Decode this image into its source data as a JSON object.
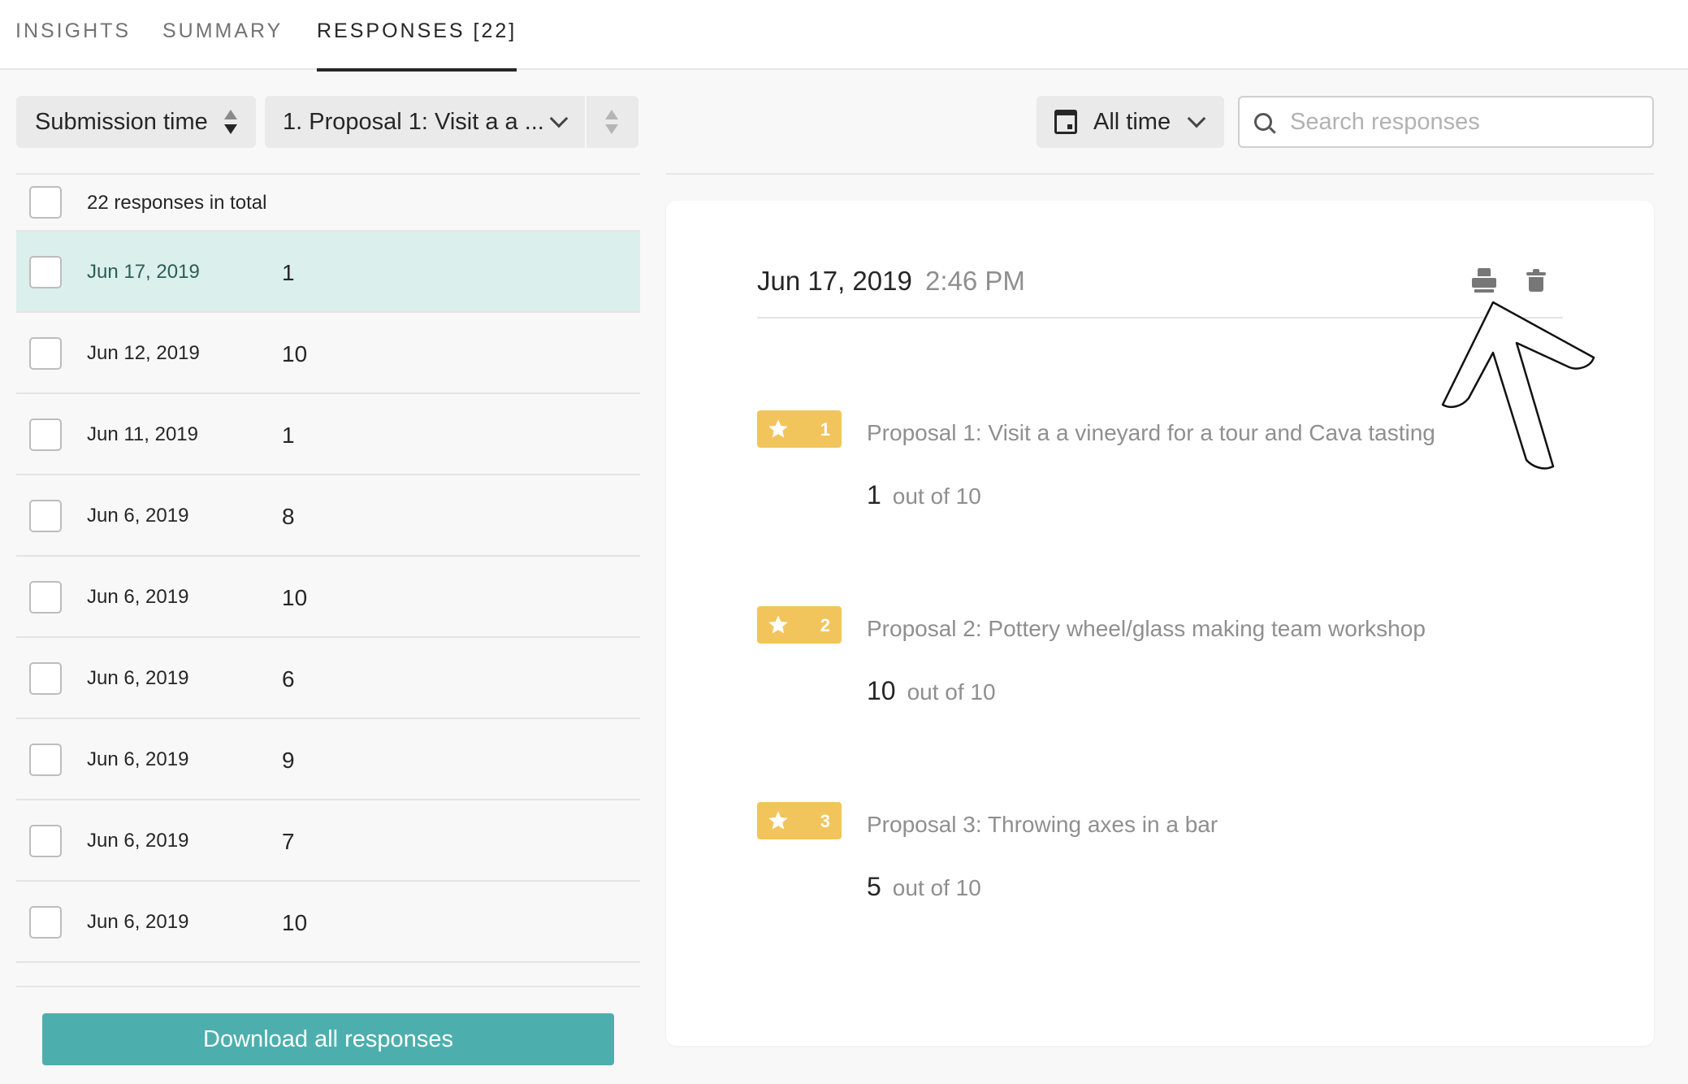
{
  "tabs": [
    {
      "label": "Insights",
      "active": false
    },
    {
      "label": "Summary",
      "active": false
    },
    {
      "label": "Responses [22]",
      "active": true
    }
  ],
  "controls": {
    "sort_label": "Submission time",
    "question_label": "1. Proposal 1: Visit a a ...",
    "date_filter_label": "All time",
    "search_placeholder": "Search responses"
  },
  "list": {
    "total_label": "22 responses in total",
    "rows": [
      {
        "date": "Jun 17, 2019",
        "score": "1",
        "selected": true
      },
      {
        "date": "Jun 12, 2019",
        "score": "10"
      },
      {
        "date": "Jun 11, 2019",
        "score": "1"
      },
      {
        "date": "Jun 6, 2019",
        "score": "8"
      },
      {
        "date": "Jun 6, 2019",
        "score": "10"
      },
      {
        "date": "Jun 6, 2019",
        "score": "6"
      },
      {
        "date": "Jun 6, 2019",
        "score": "9"
      },
      {
        "date": "Jun 6, 2019",
        "score": "7"
      },
      {
        "date": "Jun 6, 2019",
        "score": "10"
      }
    ],
    "download_label": "Download all responses"
  },
  "detail": {
    "date": "Jun 17, 2019",
    "time": "2:46 PM",
    "answers": [
      {
        "number": "1",
        "title": "Proposal 1: Visit a a vineyard for a tour and Cava tasting",
        "value": "1",
        "out_of": "out of 10"
      },
      {
        "number": "2",
        "title": "Proposal 2: Pottery wheel/glass making team workshop",
        "value": "10",
        "out_of": "out of 10"
      },
      {
        "number": "3",
        "title": "Proposal 3: Throwing axes in a bar",
        "value": "5",
        "out_of": "out of 10"
      }
    ]
  },
  "colors": {
    "accent": "#4cafad",
    "selected_row": "#dbefec",
    "badge": "#f2c55c"
  },
  "icons": [
    "sort-arrows-icon",
    "chevron-down-icon",
    "calendar-icon",
    "search-icon",
    "print-icon",
    "trash-icon",
    "star-icon",
    "pointer-arrow"
  ]
}
